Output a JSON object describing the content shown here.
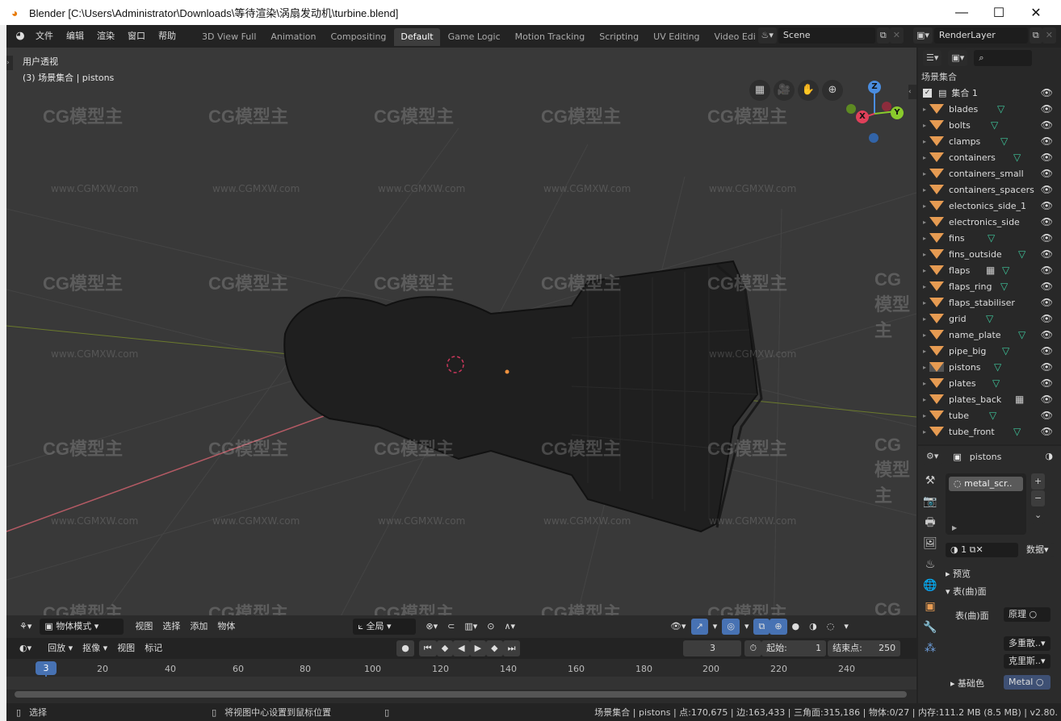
{
  "window": {
    "title": "Blender [C:\\Users\\Administrator\\Downloads\\等待渲染\\涡扇发动机\\turbine.blend]",
    "minimize": "—",
    "maximize": "☐",
    "close": "✕"
  },
  "menubar": {
    "items": [
      "文件",
      "编辑",
      "渲染",
      "窗口",
      "帮助"
    ]
  },
  "workspaces": {
    "tabs": [
      "3D View Full",
      "Animation",
      "Compositing",
      "Default",
      "Game Logic",
      "Motion Tracking",
      "Scripting",
      "UV Editing",
      "Video Edi"
    ],
    "active": "Default"
  },
  "scene": {
    "label": "Scene"
  },
  "view_layer": {
    "label": "RenderLayer"
  },
  "viewport": {
    "view_name": "用户透视",
    "context": "(3) 场景集合 | pistons",
    "gizmo": {
      "x": "X",
      "y": "Y",
      "z": "Z"
    },
    "watermark": "CG模型主",
    "watermark_url": "www.CGMXW.com"
  },
  "viewport_header": {
    "mode": "物体模式",
    "menus": [
      "视图",
      "选择",
      "添加",
      "物体"
    ],
    "transform_orientation": "全局"
  },
  "timeline_header": {
    "menus": [
      "回放",
      "抠像"
    ],
    "plain_menus": [
      "视图",
      "标记"
    ],
    "current_frame": "3",
    "start_label": "起始:",
    "start_value": "1",
    "end_label": "结束点:",
    "end_value": "250"
  },
  "timeline": {
    "current_frame": "3",
    "ticks": [
      "20",
      "40",
      "60",
      "80",
      "100",
      "120",
      "140",
      "160",
      "180",
      "200",
      "220",
      "240"
    ]
  },
  "statusbar": {
    "left_action": "选择",
    "middle_action": "将视图中心设置到鼠标位置",
    "stats": "场景集合 | pistons | 点:170,675 | 边:163,433 | 三角面:315,186 | 物体:0/27 | 内存:111.2 MB (8.5 MB) | v2.80."
  },
  "outliner": {
    "root": "场景集合",
    "collection": "集合 1",
    "items": [
      {
        "name": "blades",
        "extra": "mesh"
      },
      {
        "name": "bolts",
        "extra": "mesh"
      },
      {
        "name": "clamps",
        "extra": "mesh"
      },
      {
        "name": "containers",
        "extra": "mesh"
      },
      {
        "name": "containers_small",
        "extra": ""
      },
      {
        "name": "containers_spacers",
        "extra": ""
      },
      {
        "name": "electonics_side_1",
        "extra": ""
      },
      {
        "name": "electronics_side",
        "extra": ""
      },
      {
        "name": "fins",
        "extra": "mesh"
      },
      {
        "name": "fins_outside",
        "extra": "mesh"
      },
      {
        "name": "flaps",
        "extra": "modifier+mesh"
      },
      {
        "name": "flaps_ring",
        "extra": "mesh"
      },
      {
        "name": "flaps_stabiliser",
        "extra": ""
      },
      {
        "name": "grid",
        "extra": "mesh"
      },
      {
        "name": "name_plate",
        "extra": "mesh"
      },
      {
        "name": "pipe_big",
        "extra": "mesh"
      },
      {
        "name": "pistons",
        "extra": "mesh",
        "selected": true
      },
      {
        "name": "plates",
        "extra": "mesh"
      },
      {
        "name": "plates_back",
        "extra": "modifier"
      },
      {
        "name": "tube",
        "extra": "mesh"
      },
      {
        "name": "tube_front",
        "extra": "mesh"
      }
    ]
  },
  "properties": {
    "object_name": "pistons",
    "material_slot": "metal_scr..",
    "user_count": "1",
    "link_dropdown": "数据",
    "panels": {
      "preview": "预览",
      "surface": "表(曲)面"
    },
    "surface_label": "表(曲)面",
    "surface_value": "原理",
    "dropdown1": "多重散..",
    "dropdown2": "克里斯..",
    "base_color_label": "基础色",
    "base_color_value": "Metal"
  }
}
